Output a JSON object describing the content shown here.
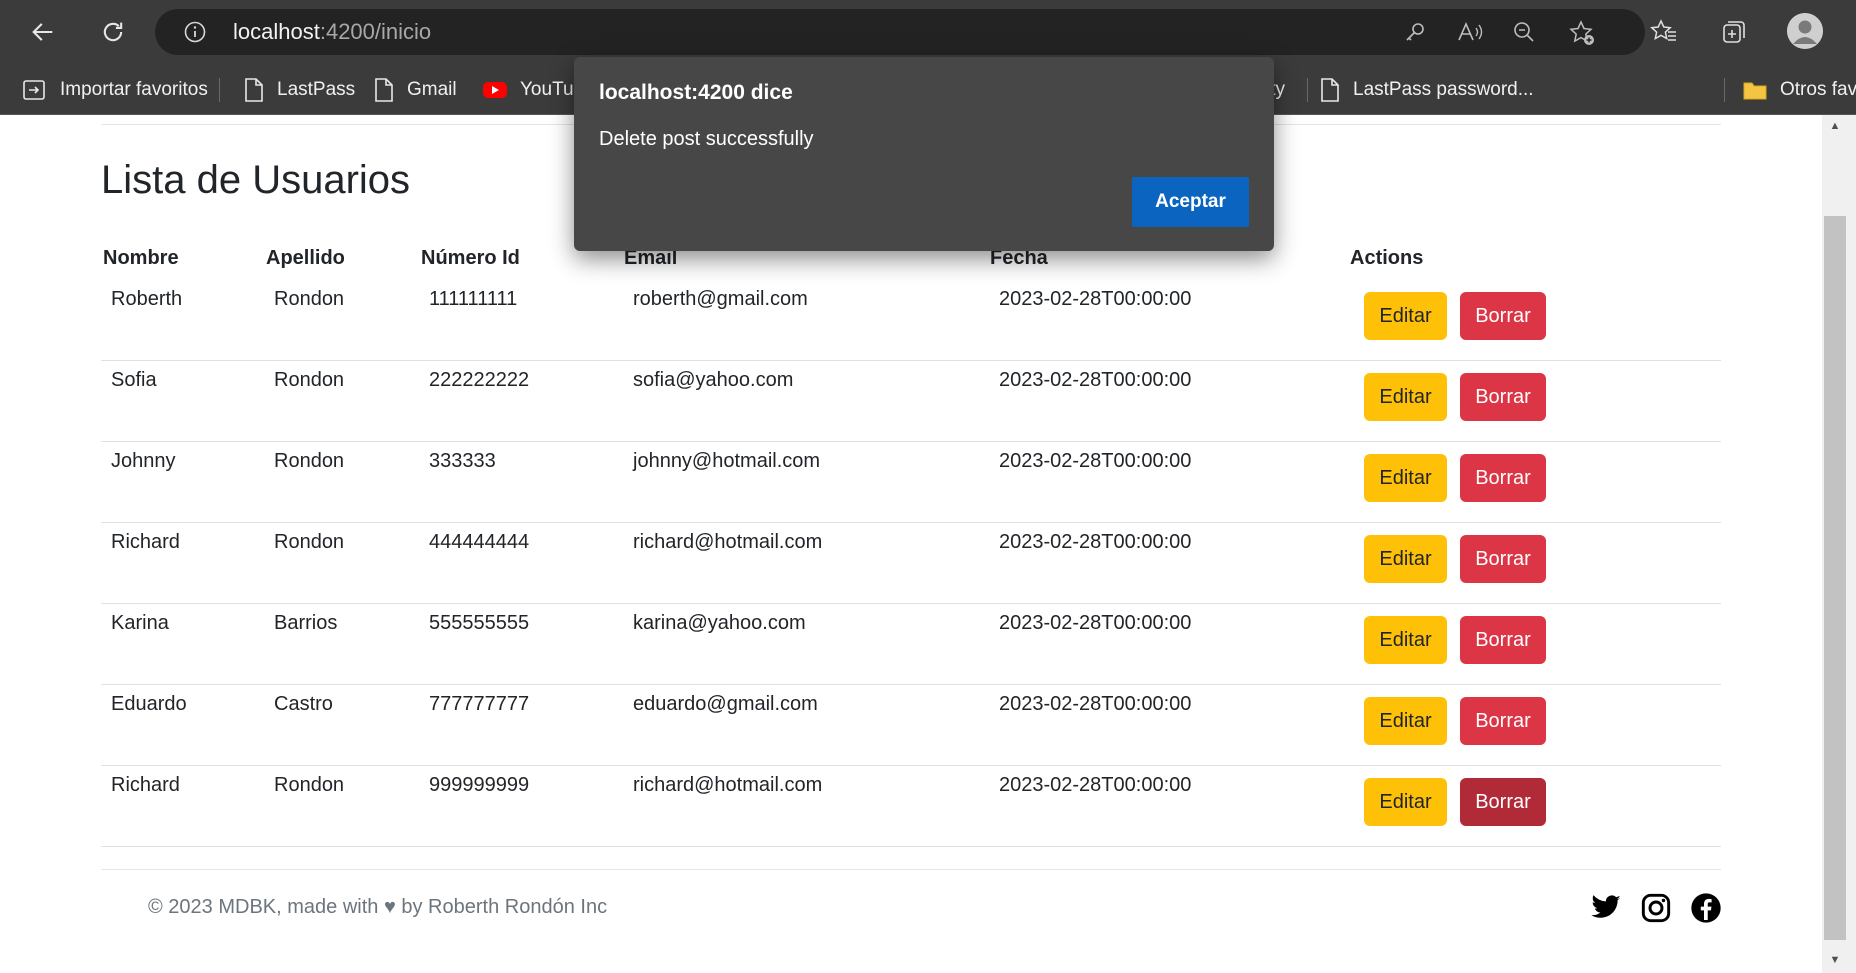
{
  "browser": {
    "url_host": "localhost",
    "url_rest": ":4200/inicio",
    "bookmarks": [
      {
        "label": "Importar favoritos",
        "icon": "import-favorites-icon"
      },
      {
        "label": "LastPass",
        "icon": "page-icon"
      },
      {
        "label": "Gmail",
        "icon": "page-icon"
      },
      {
        "label": "YouTul",
        "icon": "youtube-icon"
      },
      {
        "label": "ity",
        "icon": ""
      },
      {
        "label": "LastPass password...",
        "icon": "page-icon"
      },
      {
        "label": "Otros fav",
        "icon": "folder-icon"
      }
    ]
  },
  "page": {
    "title": "Lista de Usuarios",
    "table": {
      "headers": [
        "Nombre",
        "Apellido",
        "Número Id",
        "Email",
        "Fecha",
        "Actions"
      ],
      "rows": [
        {
          "nombre": "Roberth",
          "apellido": "Rondon",
          "id": "111111111",
          "email": "roberth@gmail.com",
          "fecha": "2023-02-28T00:00:00"
        },
        {
          "nombre": "Sofia",
          "apellido": "Rondon",
          "id": "222222222",
          "email": "sofia@yahoo.com",
          "fecha": "2023-02-28T00:00:00"
        },
        {
          "nombre": "Johnny",
          "apellido": "Rondon",
          "id": "333333",
          "email": "johnny@hotmail.com",
          "fecha": "2023-02-28T00:00:00"
        },
        {
          "nombre": "Richard",
          "apellido": "Rondon",
          "id": "444444444",
          "email": "richard@hotmail.com",
          "fecha": "2023-02-28T00:00:00"
        },
        {
          "nombre": "Karina",
          "apellido": "Barrios",
          "id": "555555555",
          "email": "karina@yahoo.com",
          "fecha": "2023-02-28T00:00:00"
        },
        {
          "nombre": "Eduardo",
          "apellido": "Castro",
          "id": "777777777",
          "email": "eduardo@gmail.com",
          "fecha": "2023-02-28T00:00:00"
        },
        {
          "nombre": "Richard",
          "apellido": "Rondon",
          "id": "999999999",
          "email": "richard@hotmail.com",
          "fecha": "2023-02-28T00:00:00"
        }
      ],
      "edit_label": "Editar",
      "delete_label": "Borrar"
    },
    "footer": {
      "text": "© 2023 MDBK, made with ♥ by Roberth Rondón Inc",
      "social_icons": [
        "twitter-icon",
        "instagram-icon",
        "facebook-icon"
      ]
    }
  },
  "dialog": {
    "title": "localhost:4200 dice",
    "message": "Delete post successfully",
    "accept_label": "Aceptar",
    "accept_color": "#0a64c0"
  },
  "colors": {
    "edit_button": "#ffc107",
    "delete_button": "#dc3545",
    "delete_button_hover": "#b02a37",
    "chrome": "#3b3b3b"
  }
}
